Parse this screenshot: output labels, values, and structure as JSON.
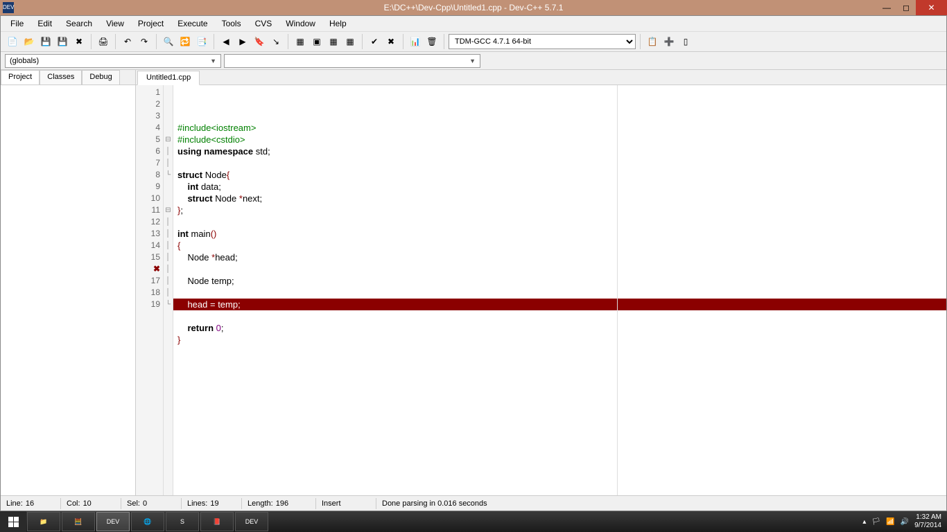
{
  "title": "E:\\DC++\\Dev-Cpp\\Untitled1.cpp - Dev-C++ 5.7.1",
  "menu": [
    "File",
    "Edit",
    "Search",
    "View",
    "Project",
    "Execute",
    "Tools",
    "CVS",
    "Window",
    "Help"
  ],
  "compiler_combo": "TDM-GCC 4.7.1 64-bit",
  "globals_combo": "(globals)",
  "side_tabs": [
    "Project",
    "Classes",
    "Debug"
  ],
  "file_tab": "Untitled1.cpp",
  "code": {
    "lines": [
      {
        "n": 1,
        "fold": "",
        "tokens": [
          {
            "t": "#include<iostream>",
            "c": "pp"
          }
        ]
      },
      {
        "n": 2,
        "fold": "",
        "tokens": [
          {
            "t": "#include<cstdio>",
            "c": "pp"
          }
        ]
      },
      {
        "n": 3,
        "fold": "",
        "tokens": [
          {
            "t": "using ",
            "c": "kw"
          },
          {
            "t": "namespace ",
            "c": "kw"
          },
          {
            "t": "std",
            "c": ""
          },
          {
            "t": ";",
            "c": ""
          }
        ]
      },
      {
        "n": 4,
        "fold": "",
        "tokens": []
      },
      {
        "n": 5,
        "fold": "⊟",
        "tokens": [
          {
            "t": "struct ",
            "c": "kw"
          },
          {
            "t": "Node",
            "c": ""
          },
          {
            "t": "{",
            "c": "br"
          }
        ]
      },
      {
        "n": 6,
        "fold": "│",
        "tokens": [
          {
            "t": "    ",
            "c": ""
          },
          {
            "t": "int ",
            "c": "kw"
          },
          {
            "t": "data",
            "c": ""
          },
          {
            "t": ";",
            "c": ""
          }
        ]
      },
      {
        "n": 7,
        "fold": "│",
        "tokens": [
          {
            "t": "    ",
            "c": ""
          },
          {
            "t": "struct ",
            "c": "kw"
          },
          {
            "t": "Node ",
            "c": ""
          },
          {
            "t": "*",
            "c": "op"
          },
          {
            "t": "next",
            "c": ""
          },
          {
            "t": ";",
            "c": ""
          }
        ]
      },
      {
        "n": 8,
        "fold": "└",
        "tokens": [
          {
            "t": "}",
            "c": "br"
          },
          {
            "t": ";",
            "c": ""
          }
        ]
      },
      {
        "n": 9,
        "fold": "",
        "tokens": []
      },
      {
        "n": 10,
        "fold": "",
        "tokens": [
          {
            "t": "int ",
            "c": "kw"
          },
          {
            "t": "main",
            "c": ""
          },
          {
            "t": "()",
            "c": "br"
          }
        ]
      },
      {
        "n": 11,
        "fold": "⊟",
        "tokens": [
          {
            "t": "{",
            "c": "br"
          }
        ]
      },
      {
        "n": 12,
        "fold": "│",
        "tokens": [
          {
            "t": "    Node ",
            "c": ""
          },
          {
            "t": "*",
            "c": "op"
          },
          {
            "t": "head",
            "c": ""
          },
          {
            "t": ";",
            "c": ""
          }
        ]
      },
      {
        "n": 13,
        "fold": "│",
        "tokens": []
      },
      {
        "n": 14,
        "fold": "│",
        "tokens": [
          {
            "t": "    Node temp",
            "c": ""
          },
          {
            "t": ";",
            "c": ""
          }
        ]
      },
      {
        "n": 15,
        "fold": "│",
        "tokens": []
      },
      {
        "n": 16,
        "fold": "│",
        "err": true,
        "tokens": [
          {
            "t": "    head ",
            "c": ""
          },
          {
            "t": "=",
            "c": ""
          },
          {
            "t": " temp",
            "c": ""
          },
          {
            "t": ";",
            "c": ""
          }
        ]
      },
      {
        "n": 17,
        "fold": "│",
        "tokens": []
      },
      {
        "n": 18,
        "fold": "│",
        "tokens": [
          {
            "t": "    ",
            "c": ""
          },
          {
            "t": "return ",
            "c": "kw"
          },
          {
            "t": "0",
            "c": "num"
          },
          {
            "t": ";",
            "c": ""
          }
        ]
      },
      {
        "n": 19,
        "fold": "└",
        "tokens": [
          {
            "t": "}",
            "c": "br"
          }
        ]
      }
    ]
  },
  "status": {
    "line_lbl": "Line:",
    "line": "16",
    "col_lbl": "Col:",
    "col": "10",
    "sel_lbl": "Sel:",
    "sel": "0",
    "lines_lbl": "Lines:",
    "lines": "19",
    "len_lbl": "Length:",
    "len": "196",
    "mode": "Insert",
    "msg": "Done parsing in 0.016 seconds"
  },
  "taskbar": {
    "apps": [
      "📁",
      "🧮",
      "DEV",
      "🌐",
      "S",
      "📕",
      "DEV"
    ],
    "time": "1:32 AM",
    "date": "9/7/2014"
  }
}
